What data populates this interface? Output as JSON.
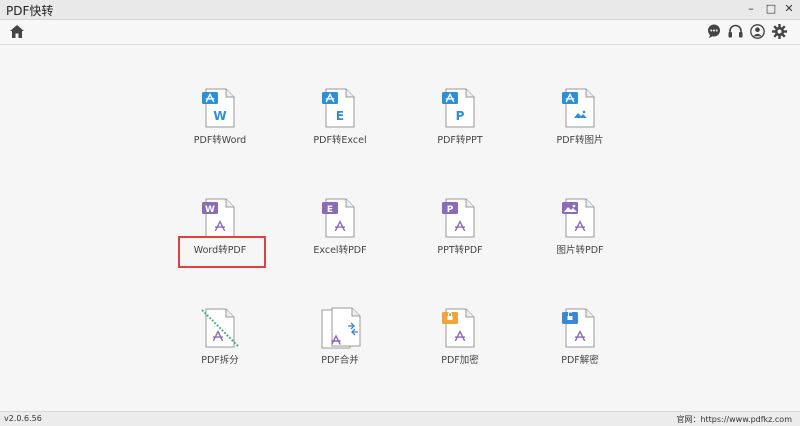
{
  "app": {
    "title": "PDF快转"
  },
  "window_controls": {
    "minimize": "–",
    "maximize": "□",
    "close": "✕"
  },
  "toolbar": {
    "icons": [
      "home-icon",
      "chat-icon",
      "headphones-icon",
      "user-icon",
      "gear-icon"
    ]
  },
  "tiles": [
    {
      "label": "PDF转Word",
      "letter": "W",
      "color": "#2d8fd5",
      "kind": "from-pdf"
    },
    {
      "label": "PDF转Excel",
      "letter": "E",
      "color": "#2d8fd5",
      "kind": "from-pdf"
    },
    {
      "label": "PDF转PPT",
      "letter": "P",
      "color": "#2d8fd5",
      "kind": "from-pdf"
    },
    {
      "label": "PDF转图片",
      "letter": "",
      "color": "#2d8fd5",
      "kind": "from-pdf-image"
    },
    {
      "label": "Word转PDF",
      "letter": "W",
      "color": "#8a6bb8",
      "kind": "to-pdf"
    },
    {
      "label": "Excel转PDF",
      "letter": "E",
      "color": "#8a6bb8",
      "kind": "to-pdf"
    },
    {
      "label": "PPT转PDF",
      "letter": "P",
      "color": "#8a6bb8",
      "kind": "to-pdf"
    },
    {
      "label": "图片转PDF",
      "letter": "",
      "color": "#8a6bb8",
      "kind": "to-pdf-image"
    },
    {
      "label": "PDF拆分",
      "letter": "",
      "color": "#8a6bb8",
      "kind": "split"
    },
    {
      "label": "PDF合并",
      "letter": "",
      "color": "#8a6bb8",
      "kind": "merge"
    },
    {
      "label": "PDF加密",
      "letter": "",
      "color": "#f0a43c",
      "kind": "lock"
    },
    {
      "label": "PDF解密",
      "letter": "",
      "color": "#3a86d8",
      "kind": "unlock"
    }
  ],
  "status": {
    "version": "v2.0.6.56",
    "website": "官网：https://www.pdfkz.com"
  }
}
